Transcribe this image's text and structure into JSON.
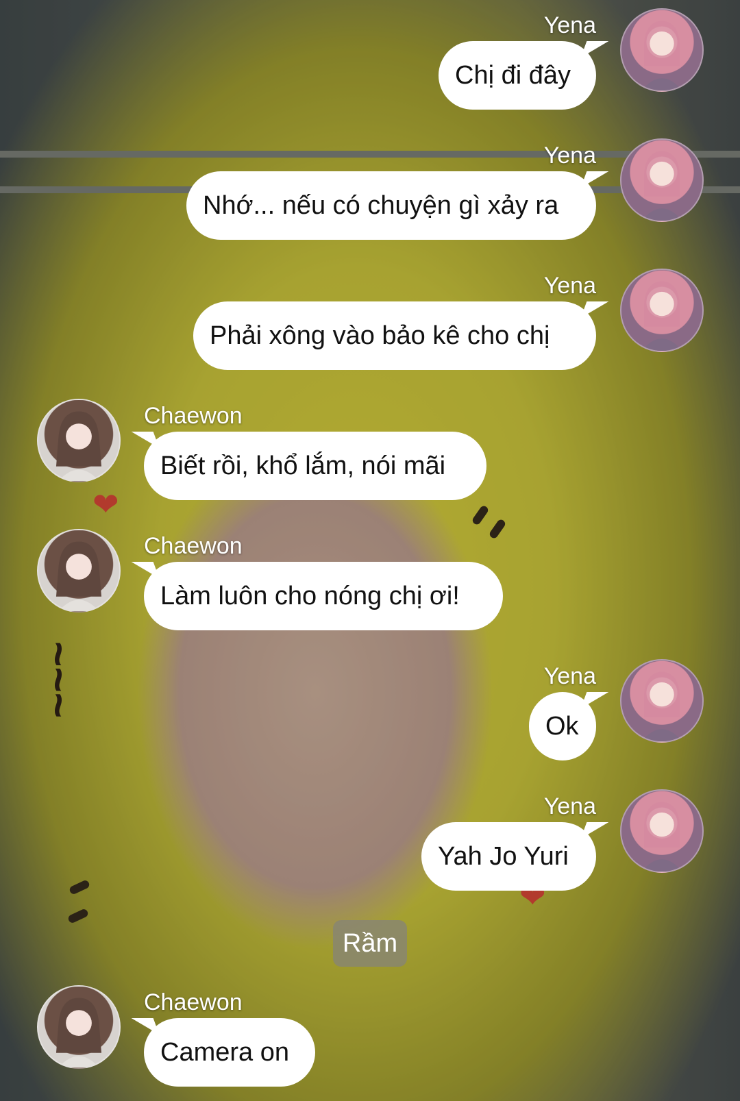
{
  "conversation": {
    "messages": [
      {
        "sender": "Yena",
        "side": "right",
        "text": "Chị đi đây"
      },
      {
        "sender": "Yena",
        "side": "right",
        "text": "Nhớ... nếu có chuyện gì xảy ra"
      },
      {
        "sender": "Yena",
        "side": "right",
        "text": "Phải xông vào bảo kê cho chị"
      },
      {
        "sender": "Chaewon",
        "side": "left",
        "text": "Biết rồi, khổ lắm, nói mãi"
      },
      {
        "sender": "Chaewon",
        "side": "left",
        "text": "Làm luôn cho nóng chị ơi!"
      },
      {
        "sender": "Yena",
        "side": "right",
        "text": "Ok"
      },
      {
        "sender": "Yena",
        "side": "right",
        "text": "Yah Jo Yuri"
      }
    ],
    "system_note": "Rầm",
    "last_message": {
      "sender": "Chaewon",
      "side": "left",
      "text": "Camera on"
    }
  },
  "colors": {
    "bubble": "#ffffff",
    "text": "#111111",
    "name": "#ffffff"
  }
}
